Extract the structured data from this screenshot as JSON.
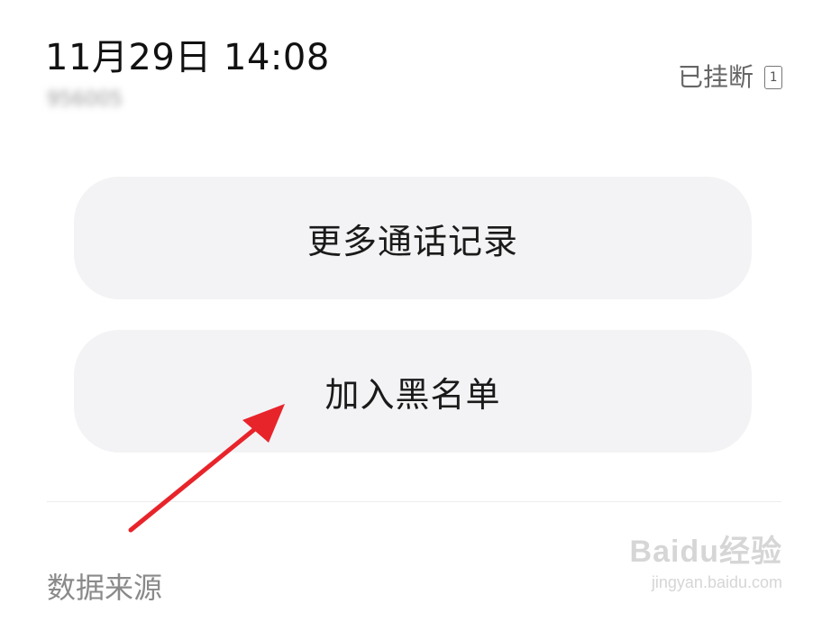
{
  "call_record": {
    "datetime": "11月29日 14:08",
    "number": "956005",
    "status": "已挂断",
    "sim_slot": "1"
  },
  "actions": {
    "more_records_label": "更多通话记录",
    "add_blacklist_label": "加入黑名单"
  },
  "footer": {
    "data_source_label": "数据来源"
  },
  "annotation": {
    "arrow_color": "#e8242b"
  },
  "watermark": {
    "logo": "Baidu经验",
    "url": "jingyan.baidu.com"
  }
}
